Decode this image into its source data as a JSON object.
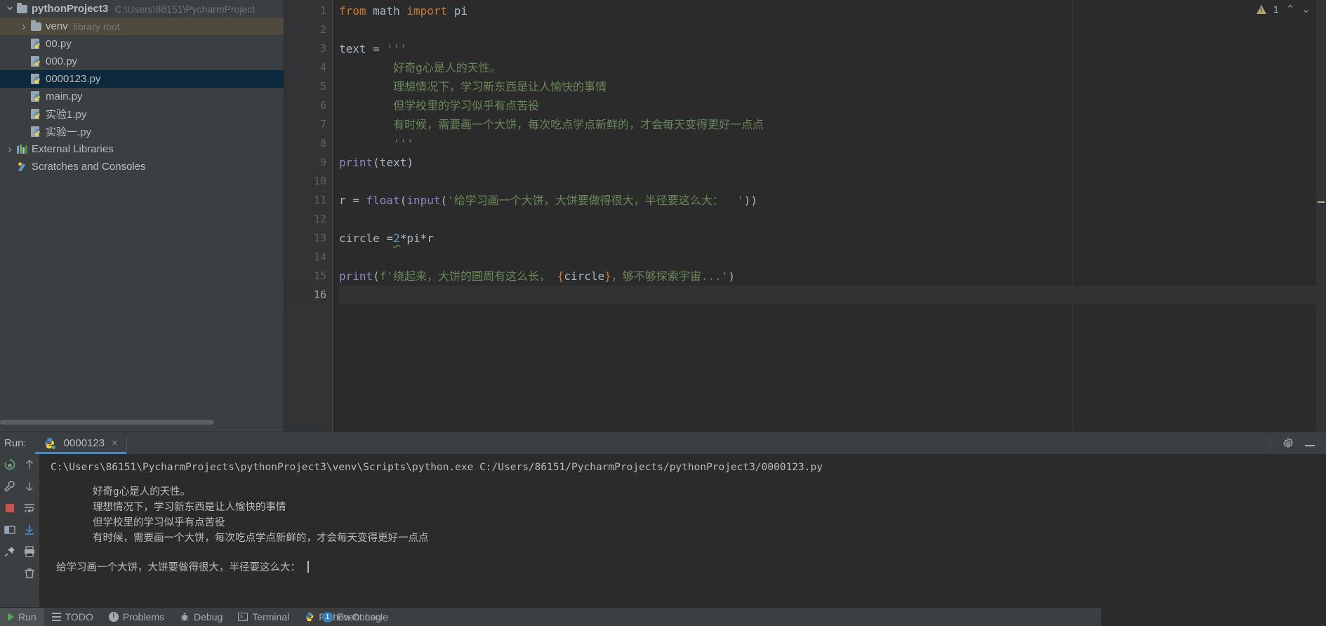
{
  "window": {
    "project_name": "pythonProject3",
    "project_path": "C:\\Users\\86151\\PycharmProject"
  },
  "sidebar": {
    "items": [
      {
        "label": "pythonProject3",
        "suffix": "C:\\Users\\86151\\PycharmProject",
        "icon": "folder-icon",
        "arrow": "down",
        "indent": 1,
        "state": "root"
      },
      {
        "label": "venv",
        "suffix": "library root",
        "icon": "folder-icon",
        "arrow": "right",
        "indent": 2,
        "state": "hovered"
      },
      {
        "label": "00.py",
        "suffix": "",
        "icon": "python-file-icon",
        "arrow": "none",
        "indent": 3,
        "state": "normal"
      },
      {
        "label": "000.py",
        "suffix": "",
        "icon": "python-file-icon",
        "arrow": "none",
        "indent": 3,
        "state": "normal"
      },
      {
        "label": "0000123.py",
        "suffix": "",
        "icon": "python-file-icon",
        "arrow": "none",
        "indent": 3,
        "state": "selected"
      },
      {
        "label": "main.py",
        "suffix": "",
        "icon": "python-file-icon",
        "arrow": "none",
        "indent": 3,
        "state": "normal"
      },
      {
        "label": "实验1.py",
        "suffix": "",
        "icon": "python-file-icon",
        "arrow": "none",
        "indent": 3,
        "state": "normal"
      },
      {
        "label": "实验一.py",
        "suffix": "",
        "icon": "python-file-icon",
        "arrow": "none",
        "indent": 3,
        "state": "normal"
      },
      {
        "label": "External Libraries",
        "suffix": "",
        "icon": "libraries-icon",
        "arrow": "right",
        "indent": 1,
        "state": "normal"
      },
      {
        "label": "Scratches and Consoles",
        "suffix": "",
        "icon": "scratches-icon",
        "arrow": "none",
        "indent": 1,
        "state": "normal"
      }
    ]
  },
  "editor": {
    "line_numbers": [
      "1",
      "2",
      "3",
      "4",
      "5",
      "6",
      "7",
      "8",
      "9",
      "10",
      "11",
      "12",
      "13",
      "14",
      "15",
      "16"
    ],
    "inspection": {
      "warning_count": "1",
      "up_arrow": "⌃",
      "down_arrow": "⌄"
    },
    "lines": [
      {
        "n": 1,
        "text": "from math import pi"
      },
      {
        "n": 2,
        "text": ""
      },
      {
        "n": 3,
        "text": "text = '''"
      },
      {
        "n": 4,
        "text": "        好奇g心是人的天性。"
      },
      {
        "n": 5,
        "text": "        理想情况下，学习新东西是让人愉快的事情"
      },
      {
        "n": 6,
        "text": "        但学校里的学习似乎有点苦役"
      },
      {
        "n": 7,
        "text": "        有时候，需要画一个大饼，每次吃点学点新鲜的，才会每天变得更好一点点"
      },
      {
        "n": 8,
        "text": "        '''"
      },
      {
        "n": 9,
        "text": "print(text)"
      },
      {
        "n": 10,
        "text": ""
      },
      {
        "n": 11,
        "text": "r = float(input('给学习画一个大饼，大饼要做得很大，半径要这么大：  '))"
      },
      {
        "n": 12,
        "text": ""
      },
      {
        "n": 13,
        "text": "circle =2*pi*r"
      },
      {
        "n": 14,
        "text": ""
      },
      {
        "n": 15,
        "text": "print(f'绕起来，大饼的圆周有这么长， {circle}，够不够探索宇宙...')"
      },
      {
        "n": 16,
        "text": ""
      }
    ],
    "tokens": {
      "l1_from": "from",
      "l1_math": " math ",
      "l1_import": "import",
      "l1_pi": " pi",
      "l3_text": "text = ",
      "l3_quote": "'''",
      "l4": "        好奇g心是人的天性。",
      "l5": "        理想情况下，学习新东西是让人愉快的事情",
      "l6": "        但学校里的学习似乎有点苦役",
      "l7": "        有时候，需要画一个大饼，每次吃点学点新鲜的，才会每天变得更好一点点",
      "l8": "        '''",
      "l9_print": "print",
      "l9_rest": "(text)",
      "l11_r": "r = ",
      "l11_float": "float",
      "l11_p1": "(",
      "l11_input": "input",
      "l11_p2": "(",
      "l11_str": "'给学习画一个大饼，大饼要做得很大，半径要这么大：  '",
      "l11_p3": "))",
      "l13_circle": "circle =",
      "l13_num": "2",
      "l13_rest": "*pi*r",
      "l15_print": "print",
      "l15_p1": "(",
      "l15_f": "f",
      "l15_s1": "'绕起来，大饼的圆周有这么长， ",
      "l15_b1": "{",
      "l15_var": "circle",
      "l15_b2": "}",
      "l15_s2": "，够不够探索宇宙...'",
      "l15_p2": ")"
    }
  },
  "run_panel": {
    "run_label": "Run:",
    "tab_name": "0000123",
    "tab_close": "×",
    "gear_title": "settings-icon",
    "minimize_title": "hide-icon",
    "command_line": "C:\\Users\\86151\\PycharmProjects\\pythonProject3\\venv\\Scripts\\python.exe C:/Users/86151/PycharmProjects/pythonProject3/0000123.py",
    "output_lines": [
      "好奇g心是人的天性。",
      "理想情况下，学习新东西是让人愉快的事情",
      "但学校里的学习似乎有点苦役",
      "有时候，需要画一个大饼，每次吃点学点新鲜的，才会每天变得更好一点点"
    ],
    "prompt_line": "给学习画一个大饼，大饼要做得很大，半径要这么大：",
    "toolbar_left": [
      "rerun-icon",
      "wrench-icon",
      "stop-icon",
      "layout-icon",
      "pin-icon"
    ],
    "toolbar_right": [
      "up-arrow-icon",
      "down-arrow-icon",
      "soft-wrap-icon",
      "scroll-to-end-icon",
      "print-icon",
      "trash-icon"
    ]
  },
  "statusbar": {
    "run_label": "Run",
    "items": [
      {
        "label": "TODO",
        "icon": "todo-icon"
      },
      {
        "label": "Problems",
        "icon": "problems-icon"
      },
      {
        "label": "Debug",
        "icon": "debug-icon"
      },
      {
        "label": "Terminal",
        "icon": "terminal-icon"
      },
      {
        "label": "Python Console",
        "icon": "python-console-icon"
      }
    ],
    "event_log": {
      "count": "1",
      "label": "Event Log"
    }
  },
  "colors": {
    "accent": "#4a88c7",
    "selected_row": "#0d293e",
    "hover_row": "#4e4a3e",
    "editor_bg": "#2b2b2b",
    "panel_bg": "#3c3f41",
    "keyword": "#cc7832",
    "string": "#6a8759",
    "function": "#8888c6",
    "number": "#6897bb",
    "warning": "#b0a072"
  }
}
